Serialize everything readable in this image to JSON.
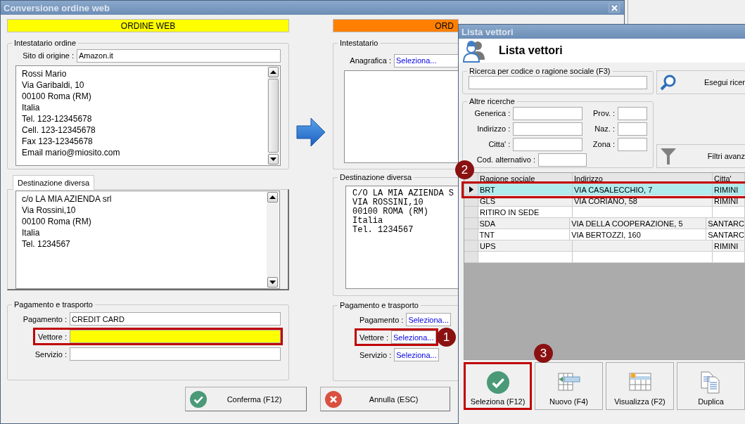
{
  "window": {
    "title": "Conversione ordine web"
  },
  "web_order": {
    "banner": {
      "text": "ORDINE WEB",
      "color": "#ffff00"
    },
    "holder": {
      "legend": "Intestatario ordine",
      "origin_label": "Sito di origine :",
      "origin_value": "Amazon.it",
      "lines": [
        "Rossi Mario",
        "Via Garibaldi, 10",
        "00100 Roma (RM)",
        "Italia",
        "Tel. 123-12345678",
        "Cell. 123-12345678",
        "Fax 123-12345678",
        "Email mario@miosito.com"
      ]
    },
    "alt_destination": {
      "tab": "Destinazione diversa",
      "lines": [
        "c/o LA MIA AZIENDA srl",
        "Via Rossini,10",
        "00100 Roma (RM)",
        "Italia",
        "Tel. 1234567"
      ]
    },
    "payment": {
      "legend": "Pagamento e trasporto",
      "fields": [
        {
          "label": "Pagamento :",
          "value": "CREDIT CARD",
          "missing": false,
          "highlighted": false
        },
        {
          "label": "Vettore :",
          "missing": true,
          "highlighted": true
        },
        {
          "label": "Servizio :",
          "missing": false,
          "highlighted": false
        }
      ]
    }
  },
  "order": {
    "banner": {
      "text": "ORD",
      "color": "#ff8000"
    },
    "holder": {
      "legend": "Intestatario",
      "registry_label": "Anagrafica :",
      "registry_value": "Seleziona..."
    },
    "alt_destination": {
      "legend": "Destinazione diversa",
      "lines": [
        "C/O LA MIA AZIENDA S",
        "VIA ROSSINI,10",
        "00100 ROMA (RM)",
        "Italia",
        "Tel. 1234567"
      ]
    },
    "payment": {
      "legend": "Pagamento e trasporto",
      "fields": [
        {
          "label": "Pagamento :",
          "value": "Seleziona...",
          "missing": false,
          "highlighted": false
        },
        {
          "label": "Vettore :",
          "value": "Seleziona...",
          "missing": false,
          "highlighted": true,
          "marker": "1"
        },
        {
          "label": "Servizio :",
          "value": "Seleziona...",
          "missing": false,
          "highlighted": false
        }
      ]
    }
  },
  "buttons": [
    {
      "label": "Conferma (F12)",
      "kind": "confirm"
    },
    {
      "label": "Annulla (ESC)",
      "kind": "cancel"
    }
  ],
  "dialog": {
    "title": "Lista vettori",
    "heading": "Lista vettori",
    "search": {
      "legend": "Ricerca per codice o ragione sociale (F3)",
      "button": "Esegui ricer"
    },
    "other": {
      "legend": "Altre ricerche",
      "fields": [
        "Generica :",
        "Indirizzo :",
        "Citta' :"
      ],
      "side_fields": [
        "Prov. :",
        "Naz. :",
        "Zona :"
      ],
      "code_label": "Cod. alternativo :"
    },
    "filters_button": "Filtri avanz",
    "table": {
      "columns": [
        "Ragione sociale",
        "Indirizzo",
        "Citta'"
      ],
      "rows": [
        {
          "cells": [
            "BRT",
            "VIA CASALECCHIO, 7",
            "RIMINI"
          ],
          "selected": true,
          "highlighted": true,
          "marker": "2"
        },
        {
          "cells": [
            "GLS",
            "VIA CORIANO, 58",
            "RIMINI"
          ],
          "selected": false,
          "highlighted": false
        },
        {
          "cells": [
            "RITIRO IN SEDE",
            "",
            ""
          ],
          "selected": false,
          "highlighted": false
        },
        {
          "cells": [
            "SDA",
            "VIA DELLA COOPERAZIONE, 5",
            "SANTARC"
          ],
          "selected": false,
          "highlighted": false
        },
        {
          "cells": [
            "TNT",
            "VIA BERTOZZI, 160",
            "SANTARC"
          ],
          "selected": false,
          "highlighted": false
        },
        {
          "cells": [
            "UPS",
            "",
            "RIMINI"
          ],
          "selected": false,
          "highlighted": false
        },
        {
          "cells": [
            "",
            "",
            ""
          ],
          "selected": false,
          "highlighted": false
        }
      ]
    },
    "actions": [
      {
        "label": "Seleziona (F12)",
        "kind": "select",
        "highlighted": true,
        "marker": "3"
      },
      {
        "label": "Nuovo (F4)",
        "kind": "new",
        "highlighted": false
      },
      {
        "label": "Visualizza (F2)",
        "kind": "view",
        "highlighted": false
      },
      {
        "label": "Duplica",
        "kind": "duplicate",
        "highlighted": false
      }
    ]
  }
}
